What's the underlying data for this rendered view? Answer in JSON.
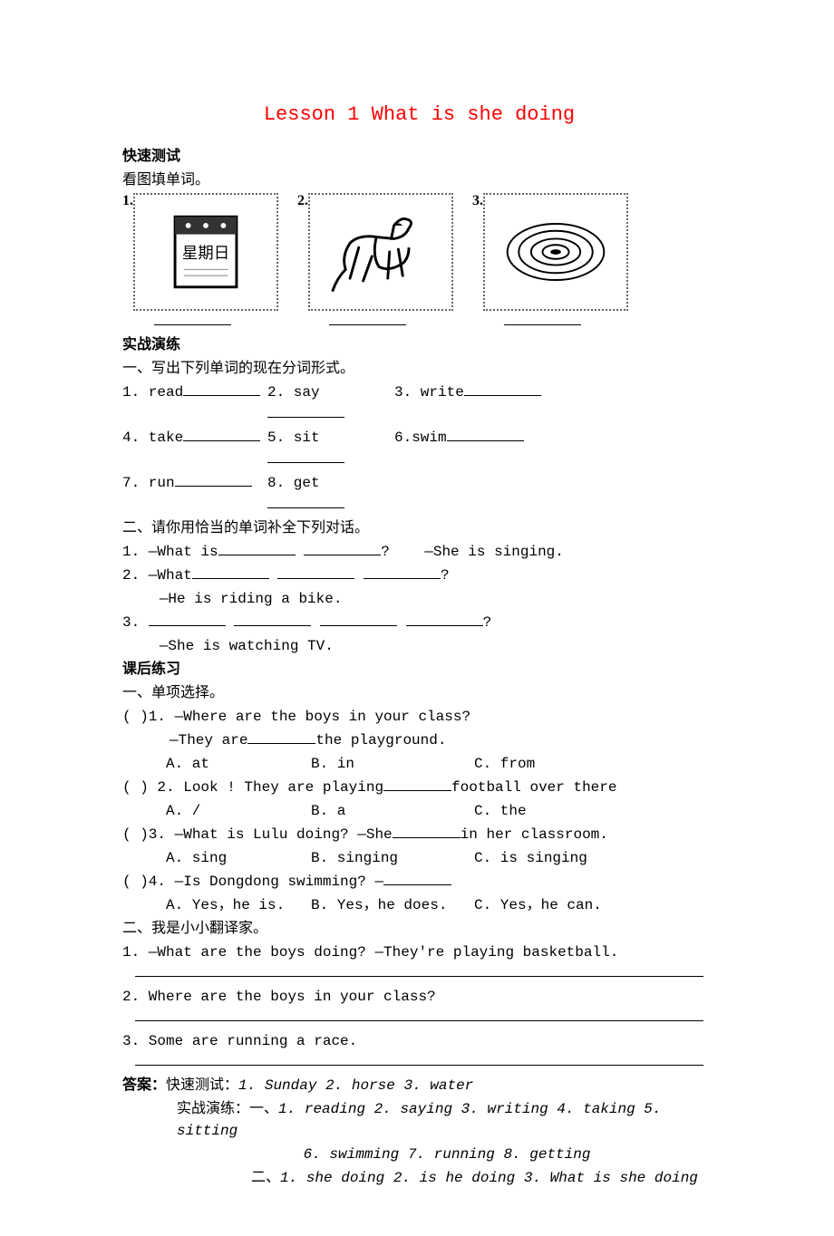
{
  "title": "Lesson 1  What is she doing",
  "sections": {
    "quickTestHeading": "快速测试",
    "quickTestInstruction": "看图填单词。",
    "imageNumbers": [
      "1.",
      "2.",
      "3."
    ],
    "practiceHeading": "实战演练",
    "ex1Instruction": "一、写出下列单词的现在分词形式。",
    "ex1": {
      "1": "1. read",
      "2": "2. say",
      "3": "3. write",
      "4": "4. take",
      "5": "5. sit",
      "6": "6.swim",
      "7": "7. run",
      "8": "8. get"
    },
    "ex2Instruction": "二、请你用恰当的单词补全下列对话。",
    "ex2": {
      "q1a": "1. —What is",
      "q1b": "?",
      "q1c": "—She is singing.",
      "q2a": "2. —What",
      "q2b": "?",
      "q2c": "—He is riding a bike.",
      "q3a": "3. ",
      "q3b": "?",
      "q3c": "—She is watching TV."
    },
    "hwHeading": "课后练习",
    "mc": {
      "heading": "一、单项选择。",
      "q1a": "(    )1. —Where are the boys in your class?",
      "q1b": "—They are",
      "q1c": "the playground.",
      "q1opts": {
        "A": "A. at",
        "B": "B. in",
        "C": "C. from"
      },
      "q2a": "(    ) 2. Look ! They are playing",
      "q2b": "football over there",
      "q2opts": {
        "A": "A. /",
        "B": "B. a",
        "C": "C. the"
      },
      "q3a": "(    )3. —What is Lulu doing?  —She",
      "q3b": "in her classroom.",
      "q3opts": {
        "A": "A. sing",
        "B": "B. singing",
        "C": "C. is singing"
      },
      "q4a": "(    )4. —Is Dongdong swimming?  —",
      "q4opts": {
        "A": "A. Yes，he is.",
        "B": "B. Yes，he does.",
        "C": "C. Yes，he can."
      }
    },
    "trans": {
      "heading": "二、我是小小翻译家。",
      "q1": "1. —What are the boys doing?  —They're playing basketball.",
      "q2": "2. Where are the boys in your class?",
      "q3": "3. Some are running a race."
    },
    "answers": {
      "label": "答案：",
      "quickLabel": "快速测试：",
      "quick": "1. Sunday 2. horse 3. water",
      "pracLabel": "实战演练：",
      "prac1Label": "一、",
      "prac1": "1. reading  2. saying  3. writing  4. taking  5. sitting",
      "prac1b": "6. swimming 7. running 8. getting",
      "prac2Label": "二、",
      "prac2": "1. she doing  2. is he doing  3. What is she doing"
    }
  }
}
